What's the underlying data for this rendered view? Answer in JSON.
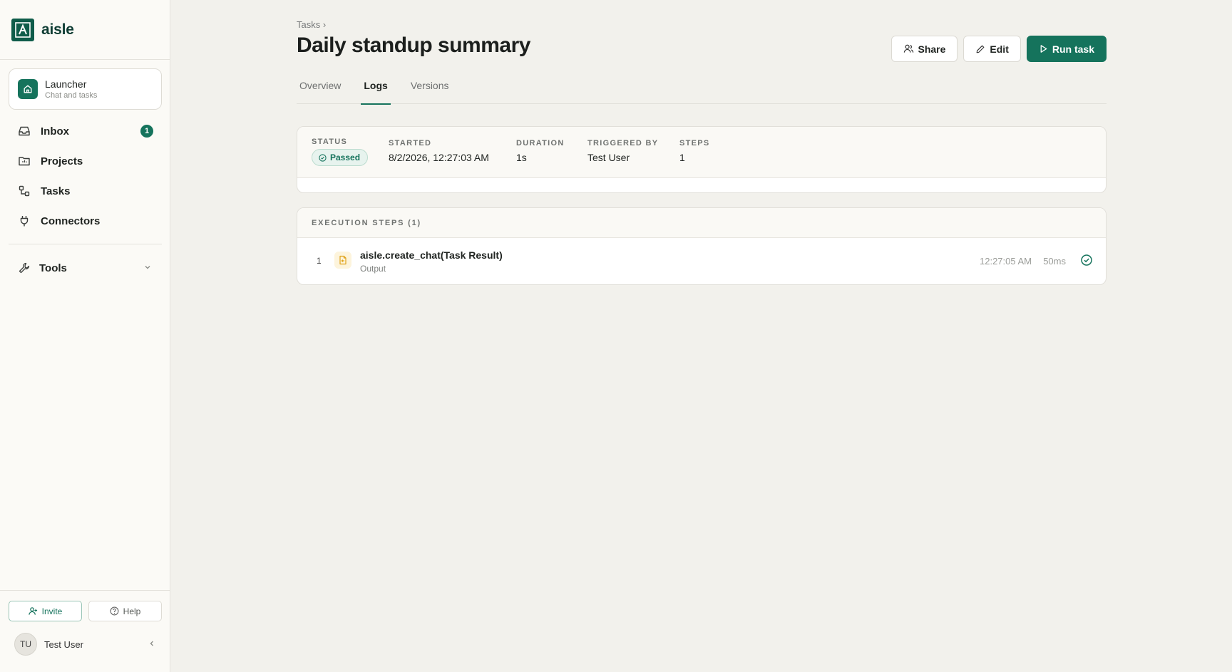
{
  "app": {
    "name": "aisle"
  },
  "sidebar": {
    "launcher": {
      "title": "Launcher",
      "subtitle": "Chat and tasks",
      "icon": "home-icon"
    },
    "items": [
      {
        "label": "Inbox",
        "icon": "inbox-icon",
        "badge": "1"
      },
      {
        "label": "Projects",
        "icon": "folder-icon"
      },
      {
        "label": "Tasks",
        "icon": "tasks-icon"
      },
      {
        "label": "Connectors",
        "icon": "plug-icon"
      }
    ],
    "tools": {
      "label": "Tools",
      "icon": "wrench-icon"
    },
    "invite_label": "Invite",
    "help_label": "Help",
    "user": {
      "initials": "TU",
      "name": "Test User"
    }
  },
  "page": {
    "breadcrumb": "Tasks ›",
    "title": "Daily standup summary",
    "actions": {
      "share": "Share",
      "edit": "Edit",
      "run": "Run task"
    },
    "tabs": [
      "Overview",
      "Logs",
      "Versions"
    ],
    "active_tab": "Logs"
  },
  "run": {
    "status_label": "STATUS",
    "status_value": "Passed",
    "started_label": "STARTED",
    "started_value": "8/2/2026, 12:27:03 AM",
    "duration_label": "DURATION",
    "duration_value": "1s",
    "triggered_label": "TRIGGERED BY",
    "triggered_value": "Test User",
    "steps_label": "STEPS",
    "steps_value": "1"
  },
  "execution": {
    "header": "EXECUTION STEPS (1)",
    "steps": [
      {
        "index": "1",
        "name": "aisle.create_chat(Task Result)",
        "type": "Output",
        "time": "12:27:05 AM",
        "duration": "50ms",
        "icon": "output-file-icon",
        "status_icon": "check-circle-icon"
      }
    ]
  },
  "colors": {
    "accent": "#15735c",
    "brand": "#0f5c4a",
    "background": "#f2f1ec",
    "sidebar": "#fbfaf6"
  }
}
